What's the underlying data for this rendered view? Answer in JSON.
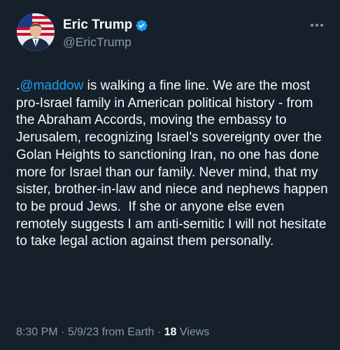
{
  "author": {
    "name": "Eric Trump",
    "handle": "@EricTrump",
    "avatar_icon": "profile-photo",
    "verified_icon": "verified-badge-icon",
    "verified_color": "#1d9bf0"
  },
  "tweet": {
    "text_prefix": ".",
    "mention": "@maddow",
    "text_body": " is walking a fine line. We are the most pro-Israel family in American political history - from the Abraham Accords, moving the embassy to Jerusalem, recognizing Israel’s sovereignty over the Golan Heights to sanctioning Iran, no one has done more for Israel than our family. Never mind, that my sister, brother-in-law and niece and nephews happen to be proud Jews.  If she or anyone else even remotely suggests I am anti-semitic I will not hesitate to take legal action against them personally."
  },
  "meta": {
    "time": "8:30 PM",
    "separator": " · ",
    "date": "5/9/23",
    "source": " from Earth",
    "separator2": " · ",
    "views_count": "18",
    "views_label": " Views"
  },
  "menu": {
    "more_icon": "more-options-icon"
  },
  "colors": {
    "background": "#15202b",
    "text": "#f7f9f9",
    "secondary": "#8b98a5",
    "accent": "#1d9bf0"
  }
}
